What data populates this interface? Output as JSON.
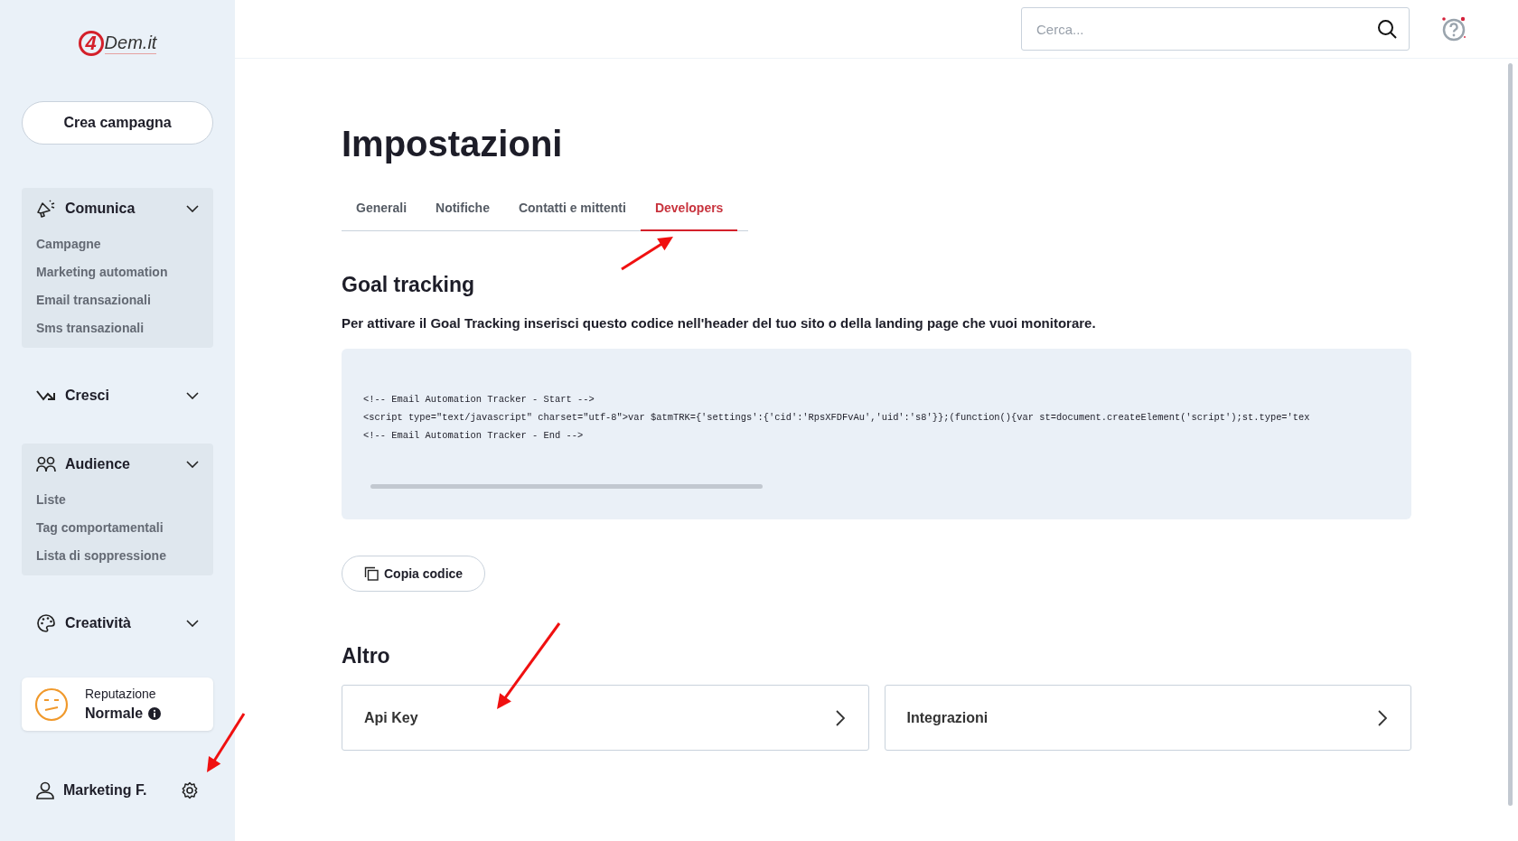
{
  "logo": {
    "mark": "4",
    "text": "Dem.it"
  },
  "sidebar": {
    "cta": "Crea campagna",
    "groups": [
      {
        "label": "Comunica",
        "items": [
          "Campagne",
          "Marketing automation",
          "Email transazionali",
          "Sms transazionali"
        ]
      },
      {
        "label": "Cresci"
      },
      {
        "label": "Audience",
        "items": [
          "Liste",
          "Tag comportamentali",
          "Lista di soppressione"
        ]
      },
      {
        "label": "Creatività"
      }
    ],
    "reputation": {
      "label": "Reputazione",
      "value": "Normale"
    },
    "user": {
      "name": "Marketing F."
    }
  },
  "search": {
    "placeholder": "Cerca..."
  },
  "page": {
    "title": "Impostazioni",
    "tabs": [
      {
        "label": "Generali",
        "selected": false
      },
      {
        "label": "Notifiche",
        "selected": false
      },
      {
        "label": "Contatti e mittenti",
        "selected": false
      },
      {
        "label": "Developers",
        "selected": true
      }
    ],
    "goal_tracking": {
      "heading": "Goal tracking",
      "description": "Per attivare il Goal Tracking inserisci questo codice nell'header del tuo sito o della landing page che vuoi monitorare.",
      "code_lines": [
        "<!-- Email Automation Tracker - Start -->",
        "<script type=\"text/javascript\" charset=\"utf-8\">var $atmTRK={'settings':{'cid':'RpsXFDFvAu','uid':'s8'}};(function(){var st=document.createElement('script');st.type='tex",
        "<!-- Email Automation Tracker - End -->"
      ],
      "copy_button": "Copia codice"
    },
    "other": {
      "heading": "Altro",
      "cards": [
        "Api Key",
        "Integrazioni"
      ]
    }
  }
}
